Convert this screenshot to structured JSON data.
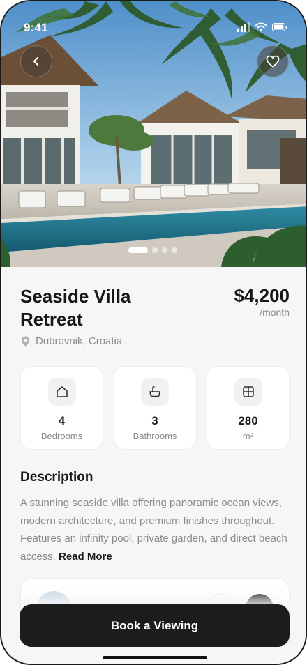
{
  "status_bar": {
    "time": "9:41"
  },
  "property": {
    "title": "Seaside Villa Retreat",
    "price": "$4,200",
    "period": "/month",
    "location": "Dubrovnik, Croatia"
  },
  "gallery": {
    "image_count": 4,
    "active_index": 0
  },
  "stats": [
    {
      "icon": "home-icon",
      "value": "4",
      "label": "Bedrooms"
    },
    {
      "icon": "bathtub-icon",
      "value": "3",
      "label": "Bathrooms"
    },
    {
      "icon": "area-grid-icon",
      "value": "280",
      "label": "m²"
    }
  ],
  "description": {
    "heading": "Description",
    "text": "A stunning seaside villa offering panoramic ocean views, modern architecture, and premium finishes throughout. Features an infinity pool, private garden, and direct beach access.",
    "read_more": "Read More"
  },
  "actions": {
    "book_label": "Book a Viewing"
  },
  "colors": {
    "primary": "#1c1c1c",
    "muted": "#8a8a8a",
    "background": "#f6f6f6",
    "card": "#ffffff"
  }
}
